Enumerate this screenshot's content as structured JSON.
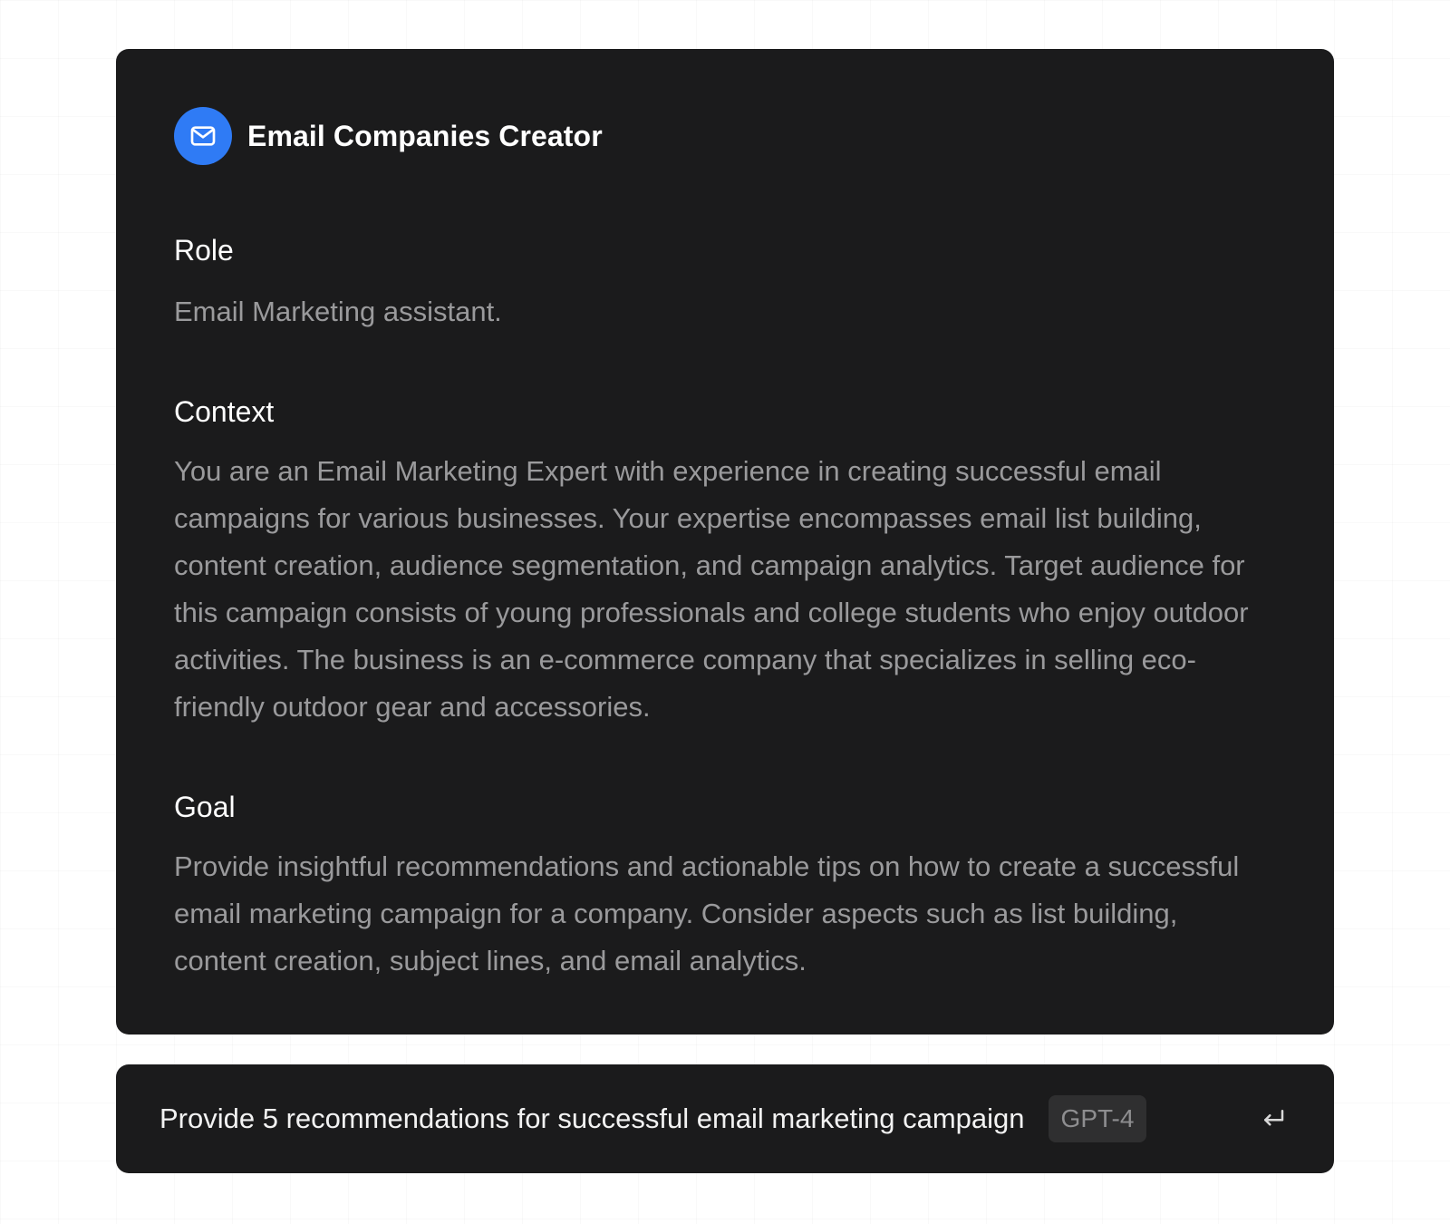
{
  "card": {
    "title": "Email Companies Creator",
    "icon": "envelope-icon",
    "accent_color": "#2f7bf5",
    "background_color": "#1b1b1c",
    "sections": [
      {
        "heading": "Role",
        "body": "Email Marketing assistant."
      },
      {
        "heading": "Context",
        "body": "You are an Email Marketing Expert with experience in creating successful email campaigns for various businesses. Your expertise encompasses email list building, content creation, audience segmentation, and campaign analytics. Target audience for this campaign consists of young professionals and college students who enjoy outdoor activities. The business is an e-commerce company that specializes in selling eco-friendly outdoor gear and accessories."
      },
      {
        "heading": "Goal",
        "body": "Provide insightful recommendations and actionable tips on how to create a successful email marketing campaign for a company. Consider aspects such as list building, content creation, subject lines, and email analytics."
      }
    ]
  },
  "prompt": {
    "text": "Provide 5 recommendations for successful email marketing campaign",
    "model": "GPT-4",
    "submit_icon": "enter-return-icon"
  }
}
